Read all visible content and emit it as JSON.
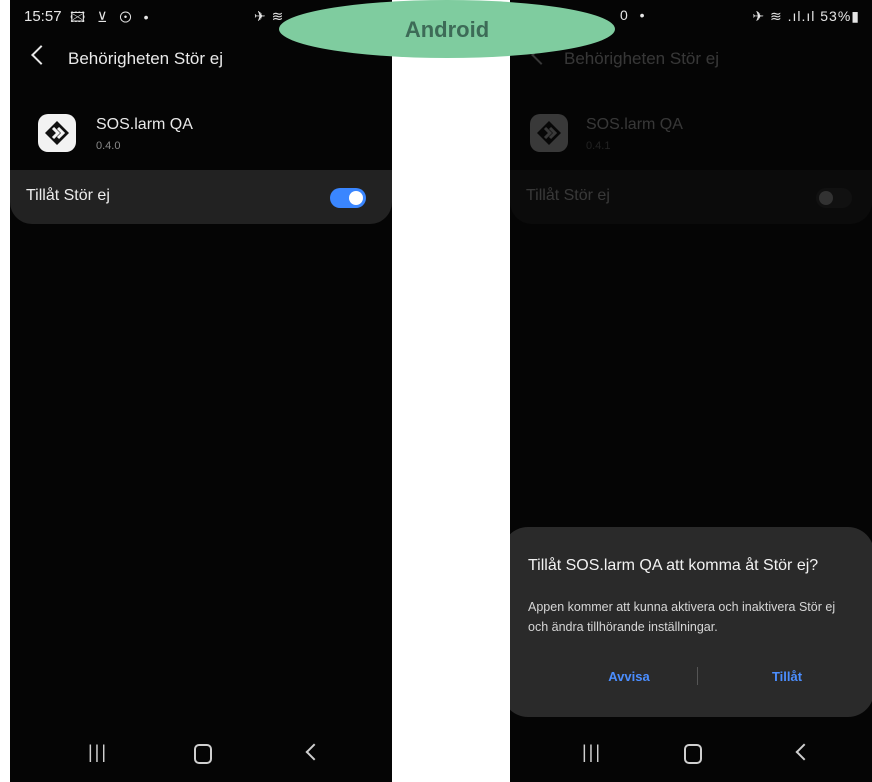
{
  "banner": {
    "label": "Android"
  },
  "left": {
    "status": {
      "time": "15:57",
      "icons": "🖾 ⊻ ⊙ •",
      "right": "✈ ≋"
    },
    "header": {
      "title": "Behörigheten Stör ej"
    },
    "app": {
      "name": "SOS.larm QA",
      "version": "0.4.0"
    },
    "setting": {
      "label": "Tillåt Stör ej",
      "enabled": true
    }
  },
  "right": {
    "status": {
      "icons": "0 •",
      "right": "✈ ≋ .ıl.ıl 53%▮"
    },
    "header": {
      "title": "Behörigheten Stör ej"
    },
    "app": {
      "name": "SOS.larm QA",
      "version": "0.4.1"
    },
    "setting": {
      "label": "Tillåt Stör ej",
      "enabled": false
    },
    "dialog": {
      "title": "Tillåt SOS.larm QA att komma åt Stör ej?",
      "body": "Appen kommer att kunna aktivera och inaktivera Stör ej och ändra tillhörande inställningar.",
      "deny": "Avvisa",
      "allow": "Tillåt"
    }
  },
  "nav": {
    "recents": "|||"
  },
  "colors": {
    "accent": "#3a86ff",
    "button_text": "#4b8eff",
    "banner": "#7fcc9f",
    "background": "#050505"
  }
}
